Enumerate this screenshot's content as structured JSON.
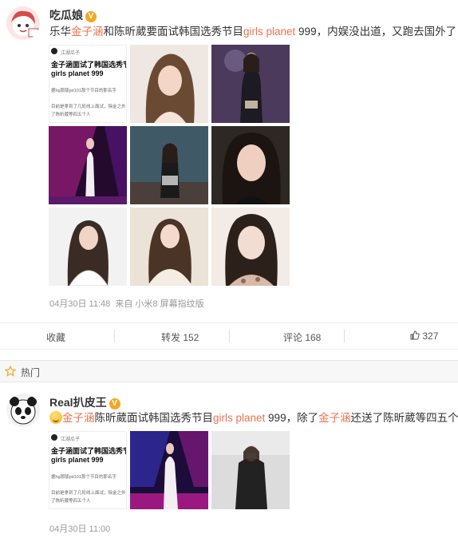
{
  "post1": {
    "username": "吃瓜娘",
    "text_before": "乐华",
    "name_hl": "金子涵",
    "text_mid": "和陈昕葳要面试韩国选秀节目",
    "show_hl": "girls planet",
    "text_after": " 999，内娱没出道，又跑去国外了",
    "timestamp": "04月30日 11:48",
    "source": "来自 小米8 屏幕指纹版",
    "card": {
      "account": "江湖瓜子",
      "title_line1": "金子涵面试了韩国选秀节",
      "title_line2": "girls planet 999",
      "line1": "据hg那版pd101那个节目的那名字",
      "line2": "目前是拿到了几轮线上面试，除金之外",
      "line3": "了陈昕葳等四五个人"
    }
  },
  "actions": {
    "favorite": "收藏",
    "repost": "转发 152",
    "comment": "评论 168",
    "like": "327"
  },
  "hot": {
    "label": "热门"
  },
  "post2": {
    "username": "Real扒皮王",
    "name_hl": "金子涵",
    "text_mid": "陈昕葳面试韩国选秀节目",
    "show_hl": "girls planet",
    "text_mid2": " 999，除了",
    "name_hl2": "金子涵",
    "text_after": "还送了陈昕葳等四五个人!",
    "timestamp": "04月30日 11:00",
    "card": {
      "account": "江湖瓜子",
      "title_line1": "金子涵面试了韩国选秀节",
      "title_line2": "girls planet 999",
      "line1": "据hg那版pd101那个节目的那名字",
      "line2": "目前是拿到了几轮线上面试，除金之外",
      "line3": "了陈昕葳等四五个人"
    }
  },
  "colors": {
    "highlight": "#eb7350",
    "badge": "#f5a623",
    "meta": "#999999"
  }
}
